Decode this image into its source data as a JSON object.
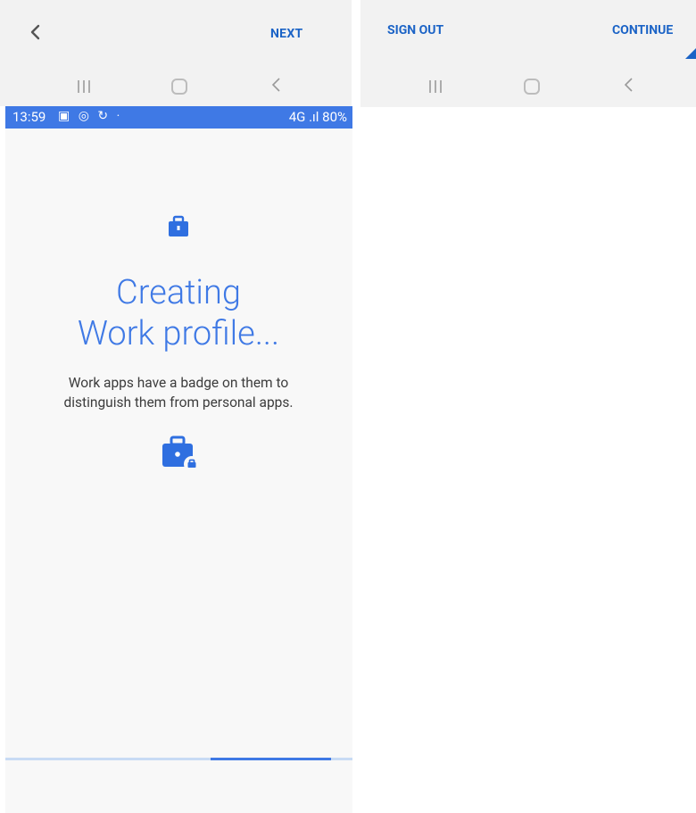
{
  "left_screen": {
    "top_bar": {
      "next_label": "NEXT"
    },
    "status_bar": {
      "time": "13:59",
      "notification_icons": "▣ ◎ ↻ ·",
      "right_text": "4G .ıl 80%"
    },
    "main": {
      "title_line1": "Creating",
      "title_line2": "Work profile...",
      "description_line1": "Work apps have a badge on them to",
      "description_line2": "distinguish them from personal apps."
    },
    "progress": {
      "value_fraction": 0.35
    }
  },
  "right_screen": {
    "sign_out_label": "SIGN OUT",
    "continue_label": "CONTINUE"
  },
  "colors": {
    "accent": "#3f79e5",
    "button_text": "#1b63c6",
    "bar_bg": "#f2f2f2",
    "content_bg": "#f8f8f8"
  },
  "icons": [
    "chevron-left-icon",
    "recents-icon",
    "home-icon",
    "back-icon",
    "briefcase-icon",
    "briefcase-badge-icon"
  ]
}
